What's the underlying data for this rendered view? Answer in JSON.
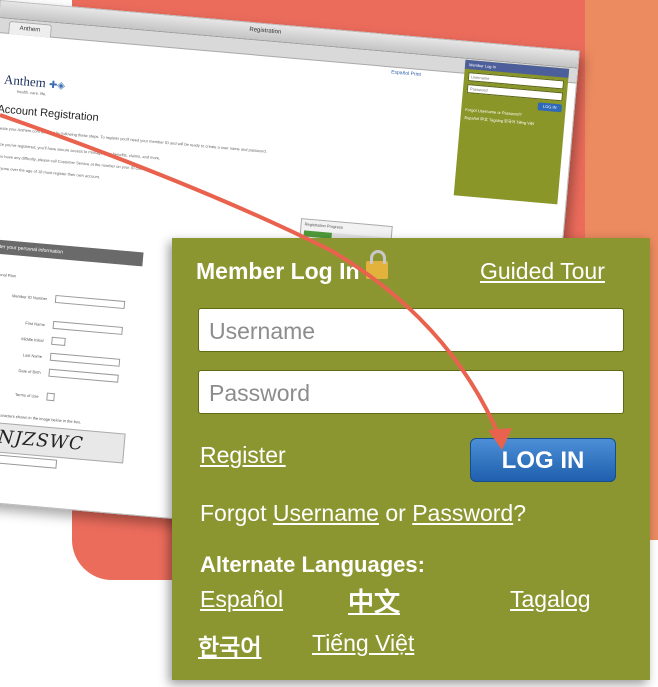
{
  "screen": {
    "window_title": "Registration",
    "tab_label": "Anthem",
    "top_links": "Español  Print",
    "logo_text": "Anthem",
    "tagline": "health. care. life.",
    "page_title": "Account Registration",
    "paragraphs": [
      "Create your Anthem.com account by following these steps. To register you'll need your member ID and will be ready to create a user name and password.",
      "Once you've registered, you'll have secure access to manage your benefits, claims, and more.",
      "If you have any difficulty, please call Customer Service at the number on your ID card.",
      "Everyone over the age of 18 must register their own account."
    ],
    "progress_label": "Registration Progress",
    "progress_fraction": 0.33,
    "section_header": "Enter your personal information",
    "form_labels": [
      "Personal Plan",
      "Member ID Number",
      "First Name",
      "Middle Initial",
      "Last Name",
      "Date of Birth",
      "Terms of Use"
    ],
    "captcha_note": "Enter the characters shown in the image below in the box.",
    "captcha_text": "VNJZSWC",
    "mini_login": {
      "header": "Member Log In",
      "username_placeholder": "Username",
      "password_placeholder": "Password",
      "button": "LOG IN",
      "forgot": "Forgot Username or Password?",
      "languages": "Español 中文 Tagalog 한국어 Tiếng Việt"
    }
  },
  "login": {
    "title": "Member Log In",
    "guided_tour": "Guided Tour",
    "username_placeholder": "Username",
    "password_placeholder": "Password",
    "register": "Register",
    "button": "LOG IN",
    "forgot_prefix": "Forgot",
    "forgot_username": "Username",
    "forgot_or": "or",
    "forgot_password": "Password",
    "forgot_suffix": "?",
    "alt_languages": "Alternate Languages:",
    "languages": [
      "Español",
      "中文",
      "Tagalog",
      "한국어",
      "Tiếng Việt"
    ]
  },
  "colors": {
    "panel": "#8c9630",
    "button": "#2f69b8",
    "arrow": "#e8624e",
    "background": "#ec6c5c"
  }
}
